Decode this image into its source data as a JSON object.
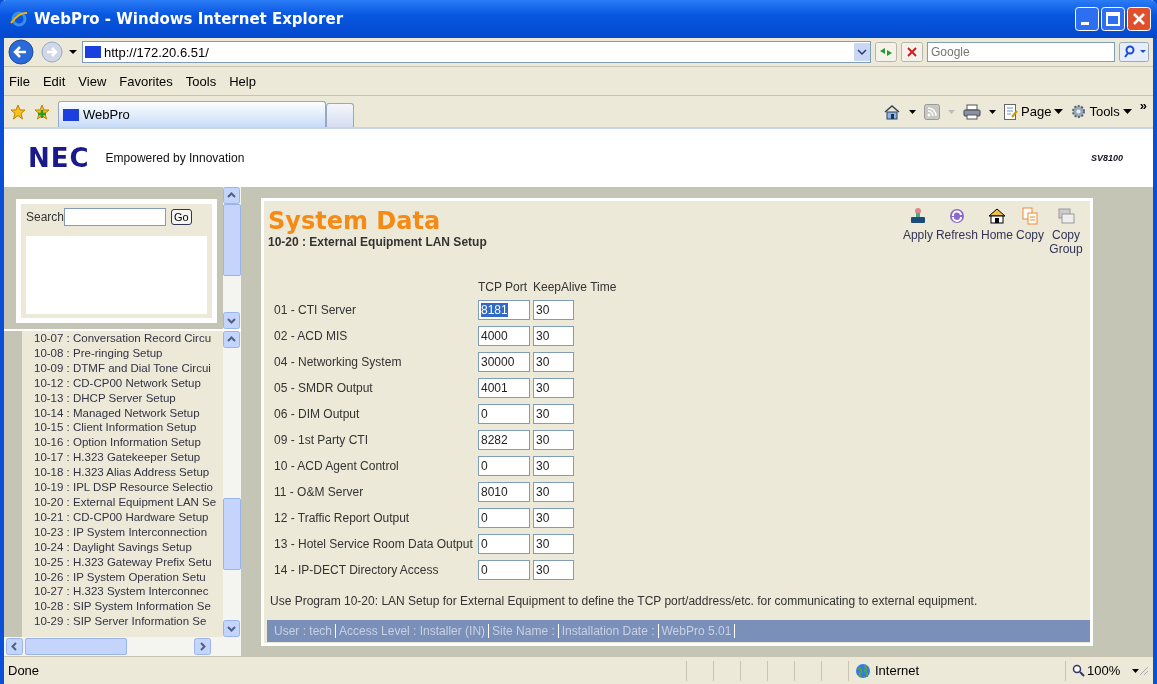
{
  "window": {
    "title": "WebPro - Windows Internet Explorer"
  },
  "address_bar": {
    "url": "http://172.20.6.51/",
    "search_placeholder": "Google"
  },
  "menu": [
    "File",
    "Edit",
    "View",
    "Favorites",
    "Tools",
    "Help"
  ],
  "tab": {
    "label": "WebPro"
  },
  "command_bar": {
    "page": "Page",
    "tools": "Tools",
    "more": "»"
  },
  "page_header": {
    "logo": "NEC",
    "tagline": "Empowered by Innovation",
    "model": "SV8100"
  },
  "sidebar": {
    "search_label": "Search",
    "go_button": "Go",
    "items": [
      "10-07 : Conversation Record Circu",
      "10-08 : Pre-ringing Setup",
      "10-09 : DTMF and Dial Tone Circui",
      "10-12 : CD-CP00 Network Setup",
      "10-13 : DHCP Server Setup",
      "10-14 : Managed Network Setup",
      "10-15 : Client Information Setup",
      "10-16 : Option Information Setup",
      "10-17 : H.323 Gatekeeper Setup",
      "10-18 : H.323 Alias Address Setup",
      "10-19 : IPL DSP Resource Selectio",
      "10-20 : External Equipment LAN Se",
      "10-21 : CD-CP00 Hardware Setup",
      "10-23 : IP System Interconnection",
      "10-24 : Daylight Savings Setup",
      "10-25 : H.323 Gateway Prefix Setu",
      "10-26 : IP System Operation Setu",
      "10-27 : H.323 System Interconnec",
      "10-28 : SIP System Information Se",
      "10-29 : SIP Server Information Se"
    ]
  },
  "content": {
    "title": "System Data",
    "subtitle": "10-20 : External Equipment LAN Setup",
    "toolbar": [
      {
        "kind": "apply",
        "label": "Apply"
      },
      {
        "kind": "refresh",
        "label": "Refresh"
      },
      {
        "kind": "home",
        "label": "Home"
      },
      {
        "kind": "copy",
        "label": "Copy"
      },
      {
        "kind": "copy_group",
        "label": "Copy Group"
      }
    ],
    "columns": [
      "TCP Port",
      "KeepAlive Time"
    ],
    "rows": [
      {
        "label": "01 - CTI Server",
        "port": "8181",
        "keepalive": "30",
        "port_selected": true
      },
      {
        "label": "02 - ACD MIS",
        "port": "4000",
        "keepalive": "30",
        "port_selected": false
      },
      {
        "label": "04 - Networking System",
        "port": "30000",
        "keepalive": "30",
        "port_selected": false
      },
      {
        "label": "05 - SMDR Output",
        "port": "4001",
        "keepalive": "30",
        "port_selected": false
      },
      {
        "label": "06 - DIM Output",
        "port": "0",
        "keepalive": "30",
        "port_selected": false
      },
      {
        "label": "09 - 1st Party CTI",
        "port": "8282",
        "keepalive": "30",
        "port_selected": false
      },
      {
        "label": "10 - ACD Agent Control",
        "port": "0",
        "keepalive": "30",
        "port_selected": false
      },
      {
        "label": "11 - O&M Server",
        "port": "8010",
        "keepalive": "30",
        "port_selected": false
      },
      {
        "label": "12 - Traffic Report Output",
        "port": "0",
        "keepalive": "30",
        "port_selected": false
      },
      {
        "label": "13 - Hotel Service Room Data Output",
        "port": "0",
        "keepalive": "30",
        "port_selected": false
      },
      {
        "label": "14 - IP-DECT Directory Access",
        "port": "0",
        "keepalive": "30",
        "port_selected": false
      }
    ],
    "note": "Use Program 10-20: LAN Setup for External Equipment to define the TCP port/address/etc. for communicating to external equipment.",
    "info_bar": [
      "User : tech",
      "Access Level : Installer (IN)",
      "Site Name :",
      "Installation Date :",
      "WebPro 5.01"
    ]
  },
  "status_bar": {
    "text": "Done",
    "zone": "Internet",
    "zoom": "100%"
  }
}
